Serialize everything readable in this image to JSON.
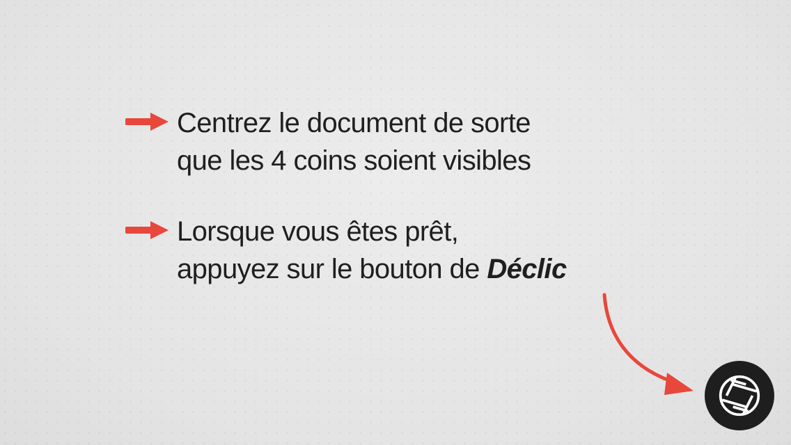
{
  "instructions": [
    {
      "line1": "Centrez le document de sorte",
      "line2": "que les 4 coins soient visibles"
    },
    {
      "line1": "Lorsque vous êtes prêt,",
      "line2_prefix": "appuyez sur le bouton de ",
      "line2_emphasis": "Déclic"
    }
  ],
  "colors": {
    "accent": "#e8473b",
    "button": "#1e1e1e",
    "text": "#1f1f1f",
    "background": "#e6e6e6"
  },
  "icons": {
    "bullet": "right-arrow-icon",
    "pointer": "curved-arrow-icon",
    "shutter": "aperture-icon"
  }
}
